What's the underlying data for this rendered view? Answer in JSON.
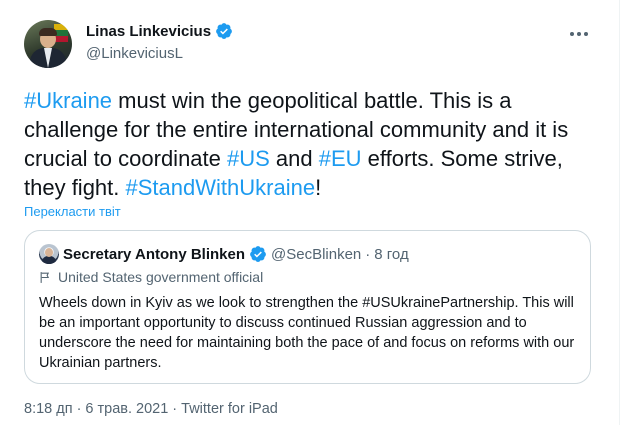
{
  "author": {
    "display_name": "Linas Linkevicius",
    "handle": "@LinkeviciusL",
    "verified": true,
    "verified_color": "#1d9bf0"
  },
  "menu": {
    "icon": "more-horizontal-icon"
  },
  "tweet": {
    "segments": [
      {
        "text": "#Ukraine",
        "kind": "hashtag"
      },
      {
        "text": " must win the geopolitical battle. This is a challenge for the entire international community and it is crucial to coordinate ",
        "kind": "text"
      },
      {
        "text": "#US",
        "kind": "hashtag"
      },
      {
        "text": " and ",
        "kind": "text"
      },
      {
        "text": "#EU",
        "kind": "hashtag"
      },
      {
        "text": " efforts. Some strive, they fight. ",
        "kind": "text"
      },
      {
        "text": "#StandWithUkraine",
        "kind": "hashtag"
      },
      {
        "text": "!",
        "kind": "text"
      }
    ],
    "translate_label": "Перекласти твіт"
  },
  "quote": {
    "display_name": "Secretary Antony Blinken",
    "handle": "@SecBlinken",
    "separator": "·",
    "time": "8 год",
    "verified": true,
    "label": "United States government official",
    "text": "Wheels down in Kyiv as we look to strengthen the #USUkrainePartnership. This will be an important opportunity to discuss continued Russian aggression and to underscore the need for maintaining both the pace of and focus on reforms with our Ukrainian partners."
  },
  "meta": {
    "time": "8:18 дп",
    "sep1": "·",
    "date": "6 трав. 2021",
    "sep2": "·",
    "source": "Twitter for iPad"
  },
  "colors": {
    "accent": "#1d9bf0",
    "text": "#0f1419",
    "secondary": "#536471",
    "border": "#cfd9de"
  }
}
